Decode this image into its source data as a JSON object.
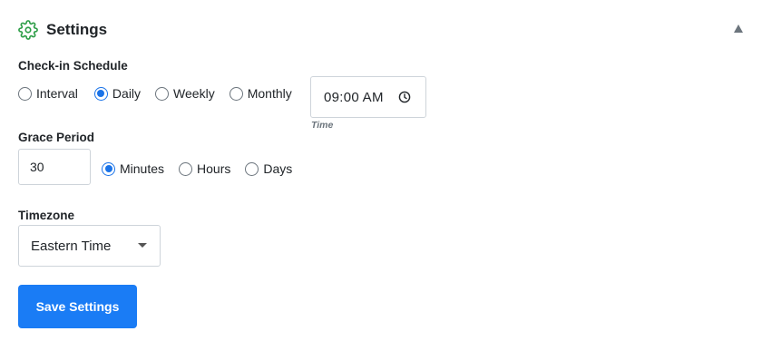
{
  "header": {
    "title": "Settings",
    "icon": "gear-icon",
    "collapse_icon": "triangle-up-icon"
  },
  "schedule": {
    "label": "Check-in Schedule",
    "options": [
      {
        "label": "Interval",
        "checked": false
      },
      {
        "label": "Daily",
        "checked": true
      },
      {
        "label": "Weekly",
        "checked": false
      },
      {
        "label": "Monthly",
        "checked": false
      }
    ],
    "time_value": "09:00 AM",
    "time_caption": "Time"
  },
  "grace": {
    "label": "Grace Period",
    "value": "30",
    "units": [
      {
        "label": "Minutes",
        "checked": true
      },
      {
        "label": "Hours",
        "checked": false
      },
      {
        "label": "Days",
        "checked": false
      }
    ]
  },
  "timezone": {
    "label": "Timezone",
    "selected": "Eastern Time"
  },
  "actions": {
    "save_label": "Save Settings"
  },
  "colors": {
    "accent": "#1a73e8",
    "button": "#1a7cf5",
    "gear": "#2e9e48"
  }
}
